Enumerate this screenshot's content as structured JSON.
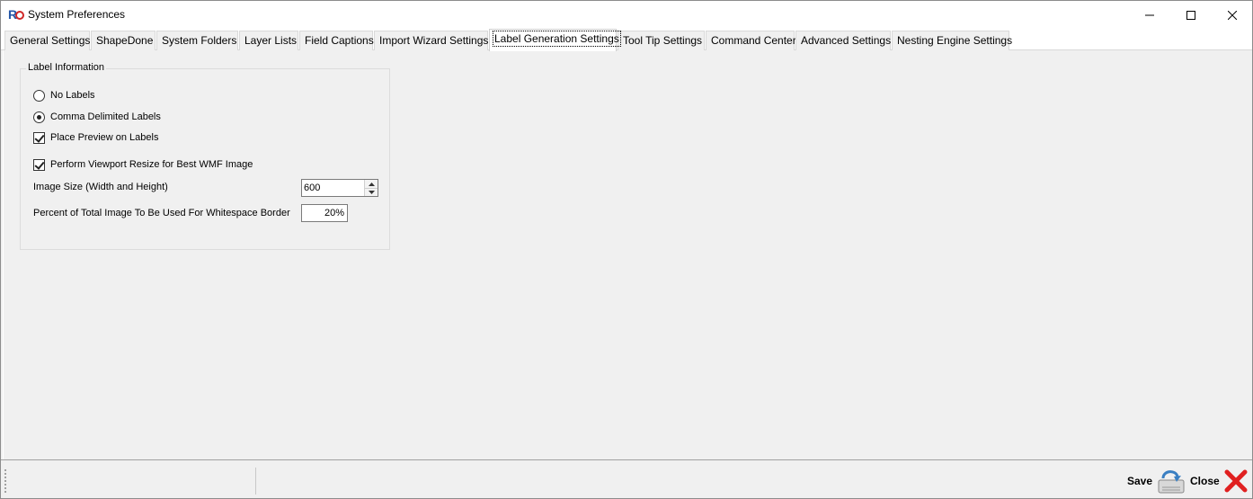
{
  "window": {
    "title": "System Preferences"
  },
  "tabs": [
    {
      "label": "General Settings",
      "active": false
    },
    {
      "label": "ShapeDone",
      "active": false
    },
    {
      "label": "System Folders",
      "active": false
    },
    {
      "label": "Layer Lists",
      "active": false
    },
    {
      "label": "Field Captions",
      "active": false
    },
    {
      "label": "Import Wizard Settings",
      "active": false
    },
    {
      "label": "Label Generation Settings",
      "active": true
    },
    {
      "label": "Tool Tip Settings",
      "active": false
    },
    {
      "label": "Command Center",
      "active": false
    },
    {
      "label": "Advanced Settings",
      "active": false
    },
    {
      "label": "Nesting Engine Settings",
      "active": false
    }
  ],
  "label_info": {
    "group_title": "Label Information",
    "no_labels": {
      "label": "No Labels",
      "checked": false
    },
    "comma_delimited": {
      "label": "Comma Delimited Labels",
      "checked": true
    },
    "place_preview": {
      "label": "Place Preview on Labels",
      "checked": true
    },
    "viewport_resize": {
      "label": "Perform Viewport Resize for Best WMF Image",
      "checked": true
    },
    "image_size_label": "Image Size (Width and Height)",
    "image_size_value": "600",
    "whitespace_label": "Percent of Total Image To Be Used For Whitespace Border",
    "whitespace_value": "20%"
  },
  "footer": {
    "save_label": "Save",
    "close_label": "Close"
  },
  "icons": {
    "app": "app-logo-icon",
    "minimize": "minimize-icon",
    "maximize": "maximize-icon",
    "close": "close-icon",
    "save": "save-disk-icon",
    "close_action": "red-x-icon"
  },
  "colors": {
    "close_red": "#e02020",
    "app_blue": "#2456a8"
  }
}
